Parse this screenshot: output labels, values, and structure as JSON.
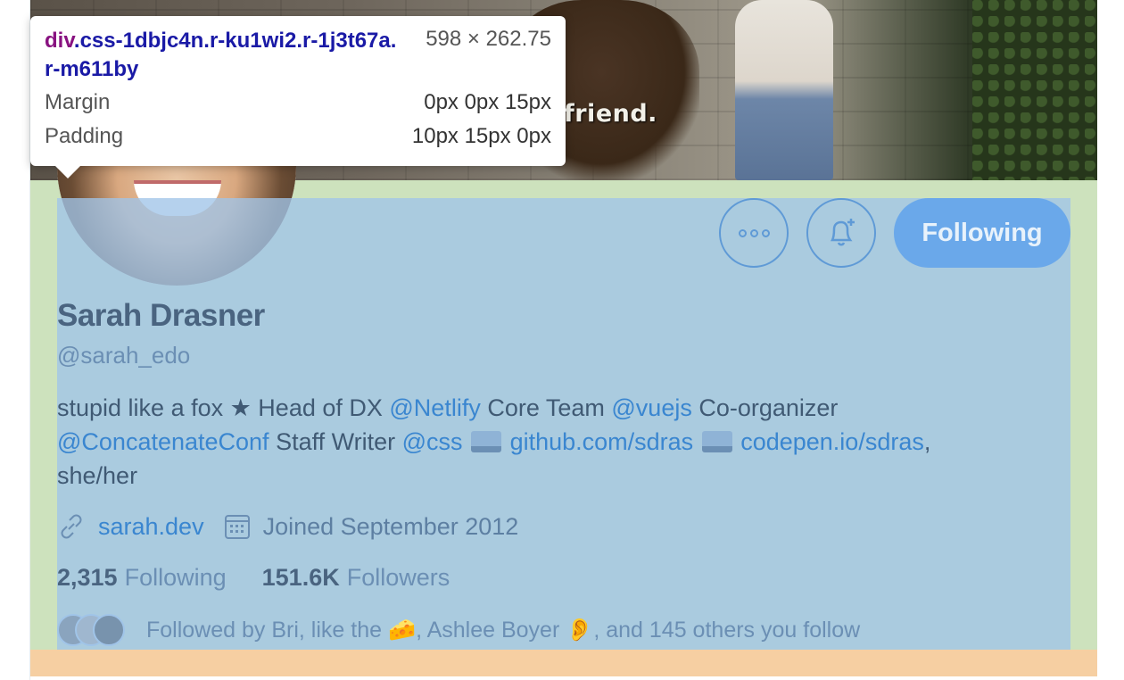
{
  "banner": {
    "subtitle": "friend."
  },
  "devtools": {
    "tag": "div",
    "classes": ".css-1dbjc4n.r-ku1wi2.r-1j3t67a.r-m611by",
    "size": "598 × 262.75",
    "margin_label": "Margin",
    "margin_value": "0px 0px 15px",
    "padding_label": "Padding",
    "padding_value": "10px 15px 0px"
  },
  "profile": {
    "follow_button": "Following",
    "more_icon": "more-icon",
    "bell_icon": "notification-bell-icon",
    "name": "Sarah Drasner",
    "handle": "@sarah_edo",
    "bio": {
      "t1": "stupid like a fox ★ Head of DX ",
      "l1": "@Netlify",
      "t2": " Core Team ",
      "l2": "@vuejs",
      "t3": " Co-organizer",
      "l3": "@ConcatenateConf",
      "t4": " Staff Writer ",
      "l4": "@css",
      "l5": "github.com/sdras",
      "l6": "codepen.io/sdras",
      "t5": ",",
      "t6": "she/her"
    },
    "website": "sarah.dev",
    "joined": "Joined September 2012",
    "following_count": "2,315",
    "following_label": "Following",
    "followers_count": "151.6K",
    "followers_label": "Followers",
    "followed_by": "Followed by Bri, like the 🧀, Ashlee Boyer 👂, and 145 others you follow"
  }
}
